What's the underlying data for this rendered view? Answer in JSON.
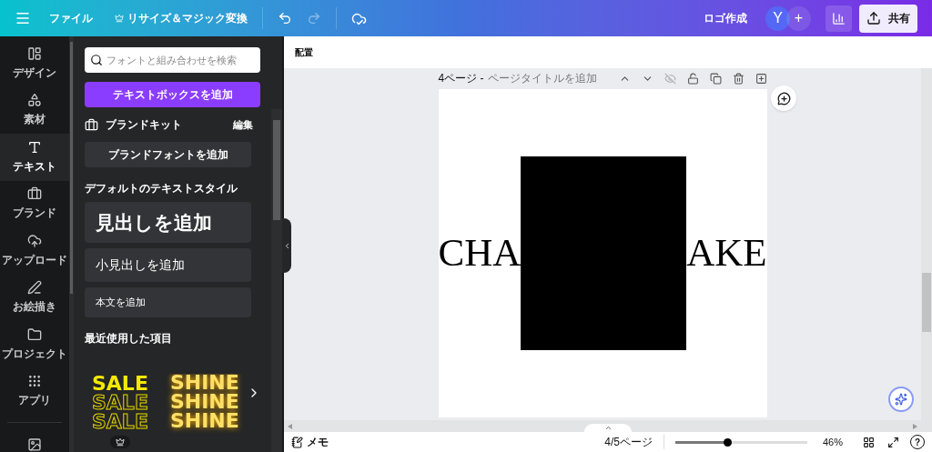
{
  "topbar": {
    "menu": "ファイル",
    "resize": "リサイズ＆マジック変換",
    "title": "ロゴ作成",
    "avatar": "Y",
    "add": "+",
    "share": "共有"
  },
  "rail": [
    {
      "label": "デザイン",
      "selected": false
    },
    {
      "label": "素材",
      "selected": false
    },
    {
      "label": "テキスト",
      "selected": true
    },
    {
      "label": "ブランド",
      "selected": false
    },
    {
      "label": "アップロード",
      "selected": false
    },
    {
      "label": "お絵描き",
      "selected": false
    },
    {
      "label": "プロジェクト",
      "selected": false
    },
    {
      "label": "アプリ",
      "selected": false
    }
  ],
  "panel": {
    "search": {
      "placeholder": "フォントと組み合わせを検索"
    },
    "add_textbox": "テキストボックスを追加",
    "brand_kit": "ブランドキット",
    "edit": "編集",
    "add_brand_font": "ブランドフォントを追加",
    "default_styles": "デフォルトのテキストスタイル",
    "styles": [
      {
        "kind": "heading",
        "label": "見出しを追加"
      },
      {
        "kind": "subheading",
        "label": "小見出しを追加"
      },
      {
        "kind": "body",
        "label": "本文を追加"
      }
    ],
    "recent_title": "最近使用した項目",
    "recent": [
      {
        "kind": "outline",
        "premium": true,
        "lines": [
          "SALE",
          "SALE",
          "SALE"
        ]
      },
      {
        "kind": "glow",
        "premium": false,
        "lines": [
          "SHINE",
          "SHINE",
          "SHINE"
        ]
      }
    ]
  },
  "toolbar": {
    "label": "配置"
  },
  "page": {
    "number": "4ページ -",
    "title_placeholder": "ページタイトルを追加",
    "text_left": "CHA",
    "text_right": "AKE"
  },
  "footer": {
    "notes": "メモ",
    "pages": "4/5ページ",
    "zoom": {
      "level": 0.39
    },
    "zoom_reading": "46%",
    "help": "?"
  }
}
